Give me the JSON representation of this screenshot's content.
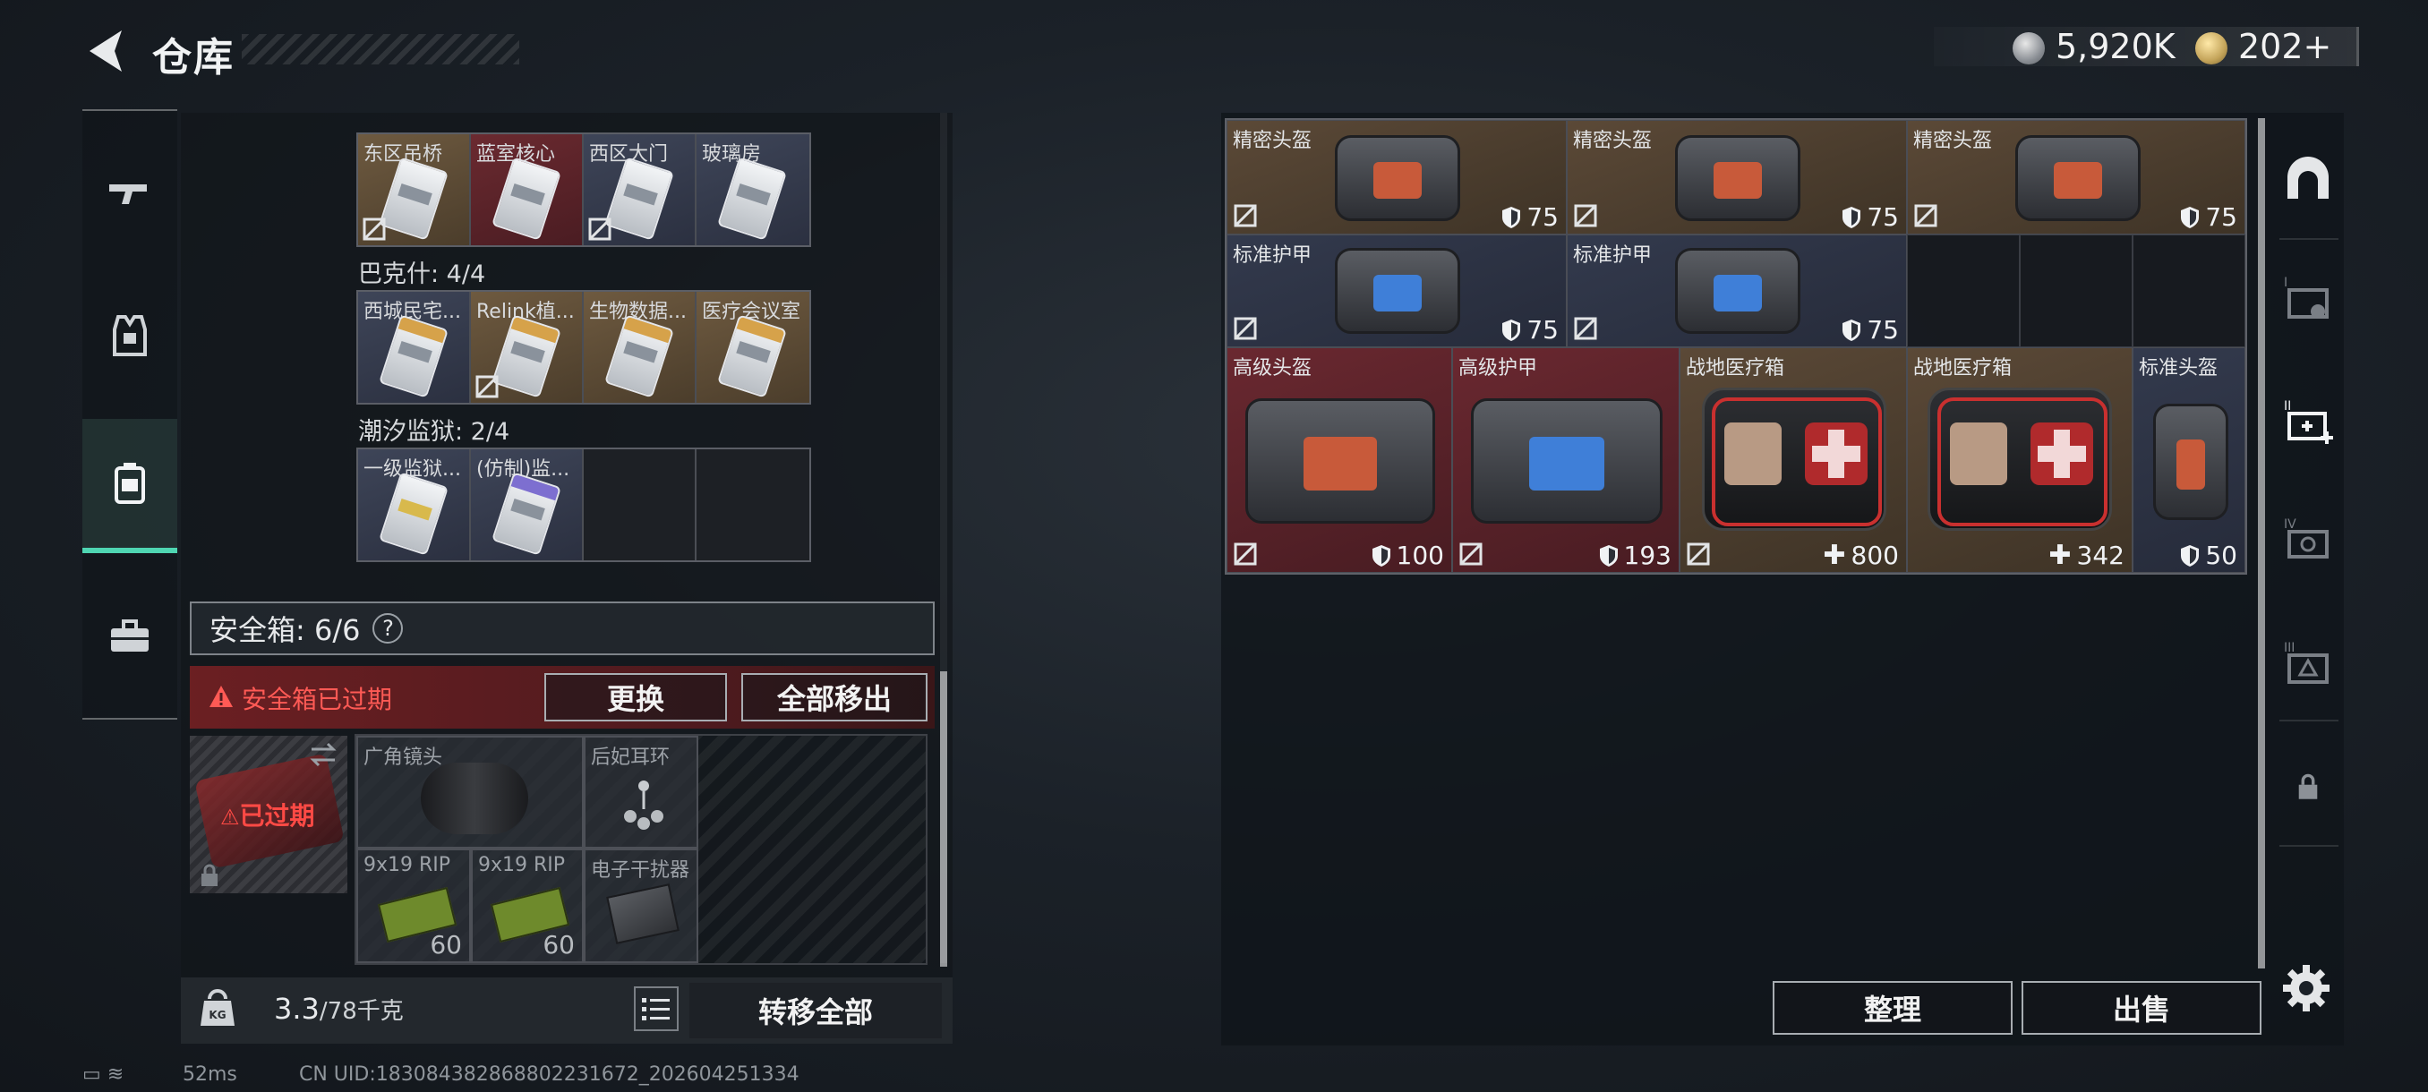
{
  "header": {
    "title": "仓库",
    "currency_silver": "5,920K",
    "currency_gold": "202+"
  },
  "left_rail": {
    "items": [
      {
        "name": "weapons-tab",
        "icon": "gun-icon"
      },
      {
        "name": "armor-tab",
        "icon": "vest-icon"
      },
      {
        "name": "containers-tab",
        "icon": "backpack-icon",
        "active": true
      },
      {
        "name": "misc-tab",
        "icon": "toolbox-icon"
      }
    ]
  },
  "keycards": {
    "top_row": [
      "东区吊桥",
      "蓝室核心",
      "西区大门",
      "玻璃房"
    ],
    "group_bakesh": {
      "label": "巴克什: 4/4",
      "cards": [
        "西城民宅...",
        "Relink植...",
        "生物数据...",
        "医疗会议室"
      ]
    },
    "group_prison": {
      "label": "潮汐监狱: 2/4",
      "cards": [
        "一级监狱...",
        "(仿制)监..."
      ]
    }
  },
  "safe_box": {
    "label": "安全箱: 6/6",
    "help": "?",
    "expired_warning": "安全箱已过期",
    "replace_label": "更换",
    "move_all_label": "全部移出",
    "slot_expired": "已过期",
    "items": [
      {
        "name": "广角镜头"
      },
      {
        "name": "后妃耳环"
      },
      {
        "name": "9x19 RIP",
        "qty": "60"
      },
      {
        "name": "9x19 RIP",
        "qty": "60"
      },
      {
        "name": "电子干扰器"
      }
    ]
  },
  "weight": {
    "current": "3.3",
    "max": "/78千克"
  },
  "transfer_all_label": "转移全部",
  "status": {
    "ping": "52ms",
    "uid": "CN UID:18308438286880223167​2_202604251334"
  },
  "warehouse": {
    "items": [
      {
        "name": "精密头盔",
        "value": "75",
        "type": "shield"
      },
      {
        "name": "精密头盔",
        "value": "75",
        "type": "shield"
      },
      {
        "name": "精密头盔",
        "value": "75",
        "type": "shield"
      },
      {
        "name": "标准护甲",
        "value": "75",
        "type": "shield"
      },
      {
        "name": "标准护甲",
        "value": "75",
        "type": "shield"
      },
      {
        "name": "高级头盔",
        "value": "100",
        "type": "shield"
      },
      {
        "name": "高级护甲",
        "value": "193",
        "type": "shield"
      },
      {
        "name": "战地医疗箱",
        "value": "800",
        "type": "heal"
      },
      {
        "name": "战地医疗箱",
        "value": "342",
        "type": "heal"
      },
      {
        "name": "标准头盔",
        "value": "50",
        "type": "shield"
      }
    ],
    "sort_label": "整理",
    "sell_label": "出售"
  },
  "colors": {
    "accent_teal": "#4fd6b2",
    "expired_red": "#ff5a55",
    "card_gold": "#5b4937",
    "card_blue": "#333a4d",
    "card_red": "#6a2830"
  }
}
